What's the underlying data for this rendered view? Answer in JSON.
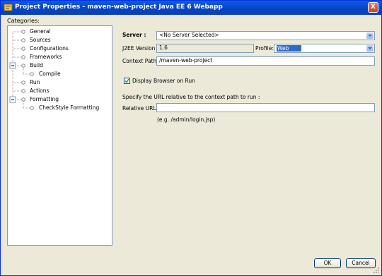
{
  "window": {
    "title": "Project Properties - maven-web-project Java EE 6 Webapp",
    "close_label": "X"
  },
  "categories": {
    "label": "Categories:",
    "items": [
      {
        "label": "General"
      },
      {
        "label": "Sources"
      },
      {
        "label": "Configurations"
      },
      {
        "label": "Frameworks"
      },
      {
        "label": "Build"
      },
      {
        "label": "Compile"
      },
      {
        "label": "Run"
      },
      {
        "label": "Actions"
      },
      {
        "label": "Formatting"
      },
      {
        "label": "CheckStyle Formatting"
      }
    ]
  },
  "run": {
    "server_label": "Server :",
    "server_value": "<No Server Selected>",
    "j2ee_label": "J2EE Version :",
    "j2ee_value": "1.6",
    "profile_label": "Profile:",
    "profile_value": "Web",
    "context_label": "Context Path :",
    "context_value": "/maven-web-project",
    "display_browser_label": "Display Browser on Run",
    "display_browser_checked": true,
    "specify_text": "Specify the URL relative to the context path to run :",
    "relative_url_label": "Relative URL :",
    "relative_url_value": "",
    "example_text": "(e.g. /admin/login.jsp)"
  },
  "buttons": {
    "ok": "OK",
    "cancel": "Cancel"
  }
}
